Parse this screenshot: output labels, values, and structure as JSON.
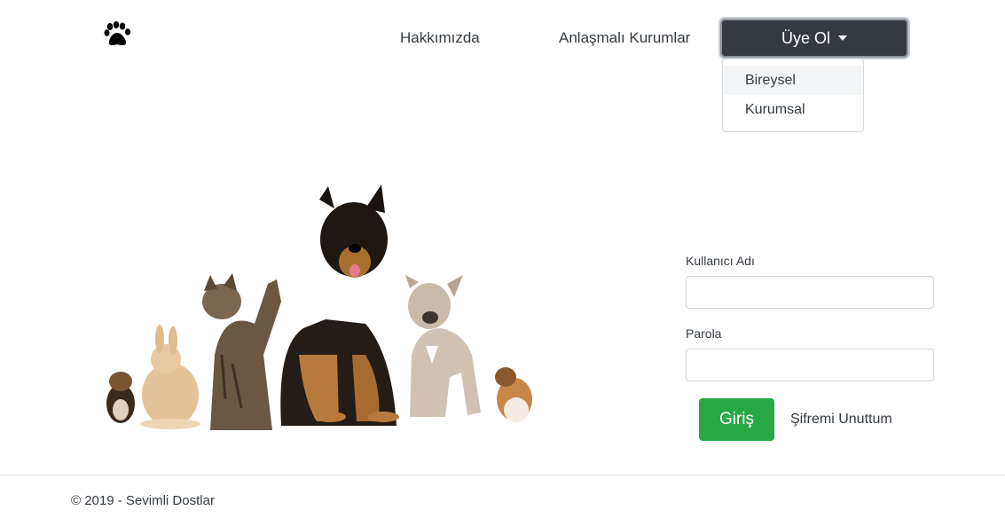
{
  "nav": {
    "brand_icon": "paw-icon",
    "about_label": "Hakkımızda",
    "partners_label": "Anlaşmalı Kurumlar",
    "signup_label": "Üye Ol",
    "signup_caret_icon": "caret-down-icon",
    "dropdown": [
      {
        "label": "Bireysel"
      },
      {
        "label": "Kurumsal"
      }
    ]
  },
  "hero": {
    "image_description": "pets-group-image"
  },
  "login": {
    "username_label": "Kullanıcı Adı",
    "username_value": "",
    "password_label": "Parola",
    "password_value": "",
    "submit_label": "Giriş",
    "forgot_label": "Şifremi Unuttum"
  },
  "footer": {
    "copyright": "© 2019 - Sevimli Dostlar"
  },
  "colors": {
    "dark": "#343a40",
    "success": "#28a745",
    "border": "#ced4da"
  }
}
